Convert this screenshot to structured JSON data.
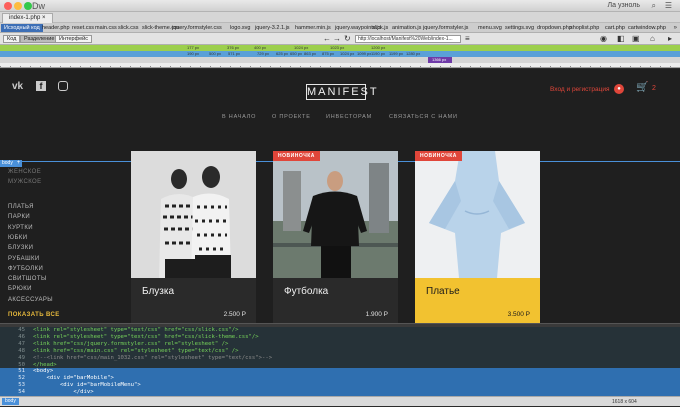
{
  "app": {
    "name": "Dw",
    "user": "Ла узноль"
  },
  "document": {
    "tab_label": "index-1.php"
  },
  "related_files": {
    "source_code_label": "Исходный код",
    "files": [
      "header.php",
      "reset.css",
      "main.css",
      "slick.css",
      "slick-theme.css",
      "jquery.formstyler.css",
      "logo.svg",
      "jquery-3.2.1.js",
      "hammer.min.js",
      "jquery.waypoints.js",
      "slick.js",
      "animation.js",
      "jquery.formstyler.js",
      "menu.svg",
      "settings.svg",
      "dropdown.php",
      "shoplist.php",
      "cart.php",
      "cartwindow.php"
    ]
  },
  "view_bar": {
    "code_btn": "Код",
    "split_btn": "Разделение",
    "live_btn": "Интерфейс",
    "url": "http://localhost/Manifest%20Web/index-1..."
  },
  "media_queries": {
    "row1": [
      "177 px",
      "376 px",
      "400 px",
      "1024 px",
      "1023 px",
      "1200 px"
    ],
    "row2": [
      "190 px",
      "500 px",
      "571 px",
      "729 px",
      "625 px",
      "650 px",
      "863 px",
      "875 px",
      "1024 px",
      "1099 px",
      "1190 px",
      "1199 px",
      "1280 px"
    ],
    "row3": [
      "1366 px"
    ]
  },
  "site": {
    "logo": "MANIFEST",
    "login": "Вход и регистрация",
    "cart_count": "2",
    "nav": [
      "В НАЧАЛО",
      "О ПРОЕКТЕ",
      "ИНВЕСТОРАМ",
      "СВЯЗАТЬСЯ С НАМИ"
    ],
    "body_tag": "body",
    "genders": [
      "ЖЕНСКОЕ",
      "МУЖСКОЕ"
    ],
    "categories": [
      "ПЛАТЬЯ",
      "ПАРКИ",
      "КУРТКИ",
      "ЮБКИ",
      "БЛУЗКИ",
      "РУБАШКИ",
      "ФУТБОЛКИ",
      "СВИТШОТЫ",
      "БРЮКИ",
      "АКСЕССУАРЫ"
    ],
    "show_all": "ПОКАЗАТЬ ВСЕ",
    "products": [
      {
        "badge": "",
        "name": "Блузка",
        "price": "2.500 Р"
      },
      {
        "badge": "НОВИНОЧКА",
        "name": "Футболка",
        "price": "1.900 Р"
      },
      {
        "badge": "НОВИНОЧКА",
        "name": "Платье",
        "price": "3.500 Р"
      }
    ]
  },
  "code": {
    "lines": [
      {
        "num": "45",
        "text": "<link rel=\"stylesheet\" type=\"text/css\" href=\"css/slick.css\"/>"
      },
      {
        "num": "46",
        "text": "<link rel=\"stylesheet\" type=\"text/css\" href=\"css/slick-theme.css\"/>"
      },
      {
        "num": "47",
        "text": "<link href=\"css/jquery.formstyler.css\" rel=\"stylesheet\" />"
      },
      {
        "num": "48",
        "text": "<link href=\"css/main.css\" rel=\"stylesheet\" type=\"text/css\" />"
      },
      {
        "num": "49",
        "text": "<!--<link href=\"css/main_1032.css\" rel=\"stylesheet\" type=\"text/css\">-->"
      },
      {
        "num": "50",
        "text": "</head>"
      },
      {
        "num": "51",
        "text": "<body>"
      },
      {
        "num": "52",
        "text": "    <div id=\"barMobile\">"
      },
      {
        "num": "53",
        "text": "        <div id=\"barMobileMenu\">"
      },
      {
        "num": "54",
        "text": "            </div>"
      }
    ]
  },
  "status": {
    "tag": "body",
    "dims": "1618 x 604"
  },
  "colors": {
    "accent": "#e0463a",
    "yellow_card": "#f2c230",
    "selection": "#2f6fb0",
    "guide": "#4a90d9"
  }
}
